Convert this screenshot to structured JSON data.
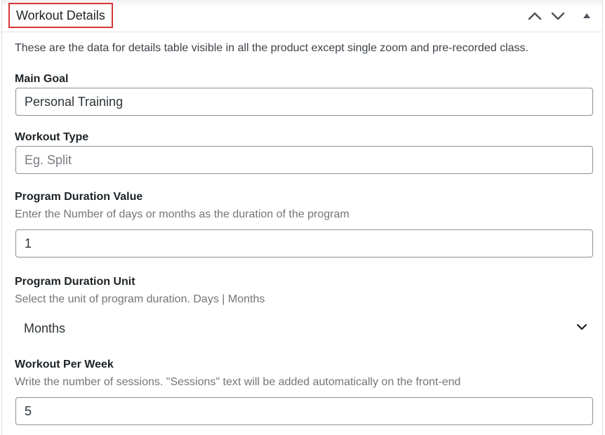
{
  "metabox": {
    "title": "Workout Details",
    "description": "These are the data for details table visible in all the product except single zoom and pre-recorded class."
  },
  "header_controls": {
    "move_up_icon": "chevron-up-icon",
    "move_down_icon": "chevron-down-icon",
    "toggle_icon": "triangle-up-icon"
  },
  "fields": {
    "main_goal": {
      "label": "Main Goal",
      "value": "Personal Training"
    },
    "workout_type": {
      "label": "Workout Type",
      "value": "",
      "placeholder": "Eg. Split"
    },
    "program_duration_value": {
      "label": "Program Duration Value",
      "help": "Enter the Number of days or months as the duration of the program",
      "value": "1"
    },
    "program_duration_unit": {
      "label": "Program Duration Unit",
      "help": "Select the unit of program duration. Days | Months",
      "selected": "Months"
    },
    "workout_per_week": {
      "label": "Workout Per Week",
      "help": "Write the number of sessions. \"Sessions\" text will be added automatically on the front-end",
      "value": "5"
    }
  },
  "colors": {
    "highlight_border": "#d63638",
    "input_border": "#8c8f94",
    "help_text": "#757575"
  }
}
